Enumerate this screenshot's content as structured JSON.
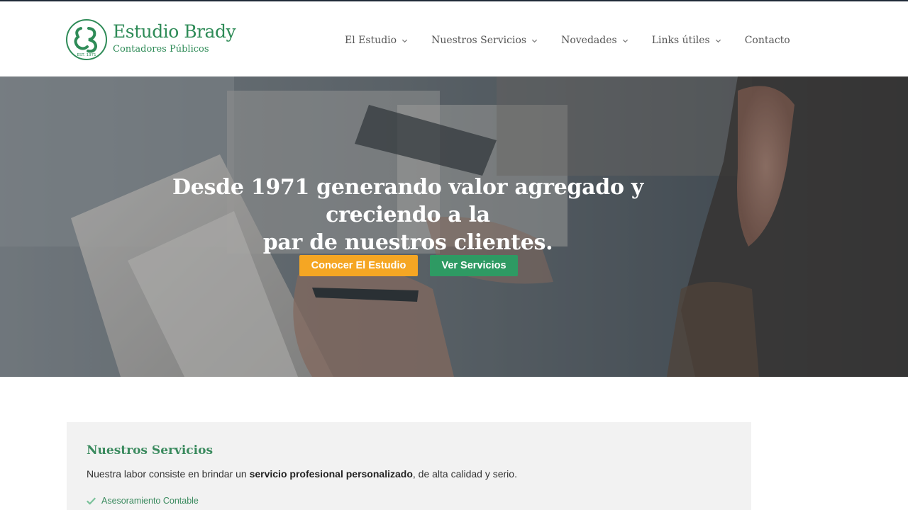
{
  "brand": {
    "name": "Estudio Brady",
    "subtitle": "Contadores Públicos",
    "est": "EST. 1971",
    "color": "#2e8b57"
  },
  "nav": {
    "items": [
      {
        "label": "El Estudio",
        "dropdown": true
      },
      {
        "label": "Nuestros Servicios",
        "dropdown": true
      },
      {
        "label": "Novedades",
        "dropdown": true
      },
      {
        "label": "Links útiles",
        "dropdown": true
      },
      {
        "label": "Contacto",
        "dropdown": false
      }
    ]
  },
  "hero": {
    "title_line1": "Desde 1971 generando valor agregado y creciendo a la",
    "title_line2": "par de nuestros clientes.",
    "primary_button": "Conocer El Estudio",
    "secondary_button": "Ver Servicios",
    "primary_color": "#f5a623",
    "secondary_color": "#2e9a63"
  },
  "services": {
    "title": "Nuestros Servicios",
    "desc_before": "Nuestra labor consiste en brindar un ",
    "desc_bold": "servicio profesional personalizado",
    "desc_after": ", de alta calidad y serio.",
    "items": [
      {
        "label": "Asesoramiento Contable",
        "icon": "check-icon"
      }
    ]
  }
}
